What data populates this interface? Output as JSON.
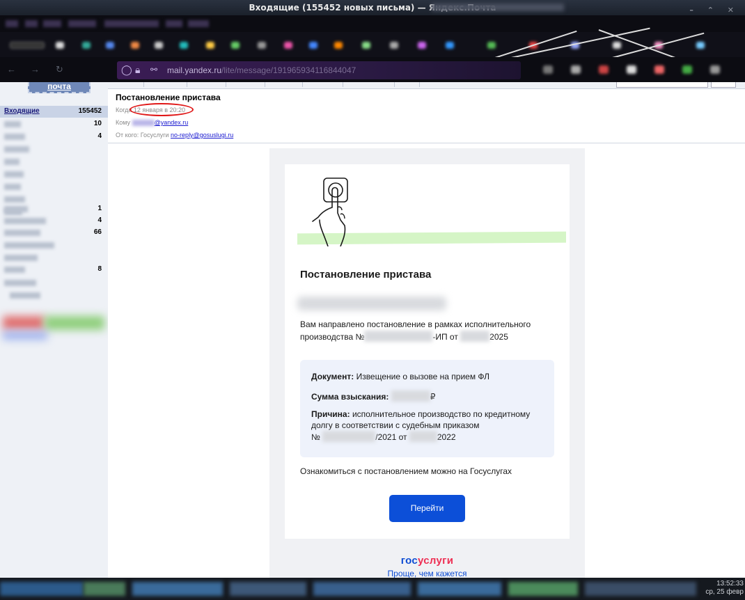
{
  "window": {
    "title": "Входящие (155452 новых письма) — Яндекс.Почта"
  },
  "browser": {
    "url_host": "mail.yandex.ru",
    "url_path": "/lite/message/191965934116844047"
  },
  "sidebar": {
    "logo": "почта",
    "folders": [
      {
        "name": "Входящие",
        "count": "155452",
        "active": true
      },
      {
        "name": "",
        "count": "10"
      },
      {
        "name": "",
        "count": "4"
      },
      {
        "name": "",
        "count": ""
      },
      {
        "name": "",
        "count": ""
      },
      {
        "name": "",
        "count": ""
      },
      {
        "name": "",
        "count": ""
      },
      {
        "name": "",
        "count": ""
      },
      {
        "name": "",
        "count": ""
      },
      {
        "name": "",
        "count": "1"
      },
      {
        "name": "",
        "count": "4"
      },
      {
        "name": "",
        "count": "66"
      },
      {
        "name": "",
        "count": ""
      },
      {
        "name": "",
        "count": ""
      },
      {
        "name": "",
        "count": "8"
      }
    ]
  },
  "message": {
    "subject": "Постановление пристава",
    "when_label": "Когда",
    "when_value": "12 января в 20:20",
    "to_label": "Кому",
    "to_value": "@yandex.ru",
    "from_label": "От кого:",
    "from_name": "Госуслуги",
    "from_email": "no-reply@gosuslugi.ru"
  },
  "email": {
    "title": "Постановление пристава",
    "intro_1": "Вам направлено постановление в рамках исполнительного производства №",
    "intro_2": "-ИП от",
    "intro_3": "2025",
    "doc_label": "Документ:",
    "doc_value": "Извещение о вызове на прием ФЛ",
    "sum_label": "Сумма взыскания:",
    "sum_currency": "₽",
    "reason_label": "Причина:",
    "reason_value": "исполнительное производство по кредитному долгу в соответствии с судебным приказом",
    "reason_num_prefix": "№",
    "reason_num_mid": "/2021 от",
    "reason_num_end": "2022",
    "outro": "Ознакомиться с постановлением можно на Госуслугах",
    "button_label": "Перейти",
    "brand_part1": "гос",
    "brand_part2": "услуги",
    "tagline": "Проще, чем кажется"
  },
  "taskbar": {
    "time": "13:52:33",
    "date": "ср, 25 февр"
  }
}
